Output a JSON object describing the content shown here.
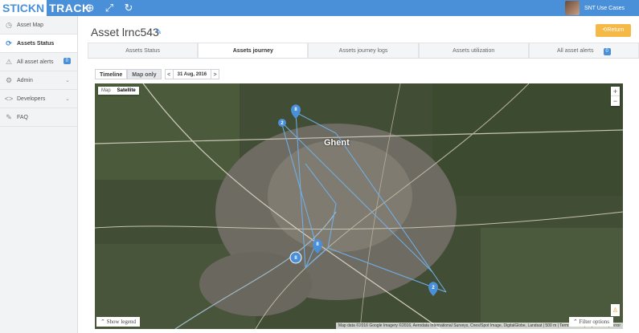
{
  "header": {
    "logo_part1": "STICKN",
    "logo_part2": "TRACK",
    "user_name": "SNT Use Cases"
  },
  "sidebar": {
    "items": [
      {
        "label": "Asset Map",
        "icon": "clock-icon"
      },
      {
        "label": "Assets Status",
        "icon": "refresh-icon"
      },
      {
        "label": "All asset alerts",
        "icon": "warning-icon",
        "badge": "0"
      },
      {
        "label": "Admin",
        "icon": "gear-icon"
      },
      {
        "label": "Developers",
        "icon": "code-icon"
      },
      {
        "label": "FAQ",
        "icon": "pencil-icon"
      }
    ]
  },
  "page": {
    "title": "Asset lrnc543",
    "return_label": "Return"
  },
  "tabs": [
    {
      "label": "Assets Status"
    },
    {
      "label": "Assets journey"
    },
    {
      "label": "Assets journey logs"
    },
    {
      "label": "Assets utilization"
    },
    {
      "label": "All asset alerts",
      "badge": "0"
    }
  ],
  "viewbar": {
    "timeline": "Timeline",
    "map_only": "Map only",
    "prev": "<",
    "date": "31 Aug, 2016",
    "next": ">"
  },
  "map": {
    "type_map": "Map",
    "type_satellite": "Satellite",
    "zoom_in": "+",
    "zoom_out": "−",
    "city": "Ghent",
    "show_legend": "Show legend",
    "filter_options": "Filter options",
    "attribution": "Map data ©2016 Google Imagery ©2016, Aerodata International Surveys, Cnes/Spot Image, DigitalGlobe, Landsat | 500 m | Terms of Use | Report a map error",
    "marker_labels": [
      "2",
      "2",
      "II",
      "II",
      "II"
    ]
  },
  "colors": {
    "brand": "#4a90d9",
    "return": "#f5b947",
    "route": "#6fb2ec"
  }
}
